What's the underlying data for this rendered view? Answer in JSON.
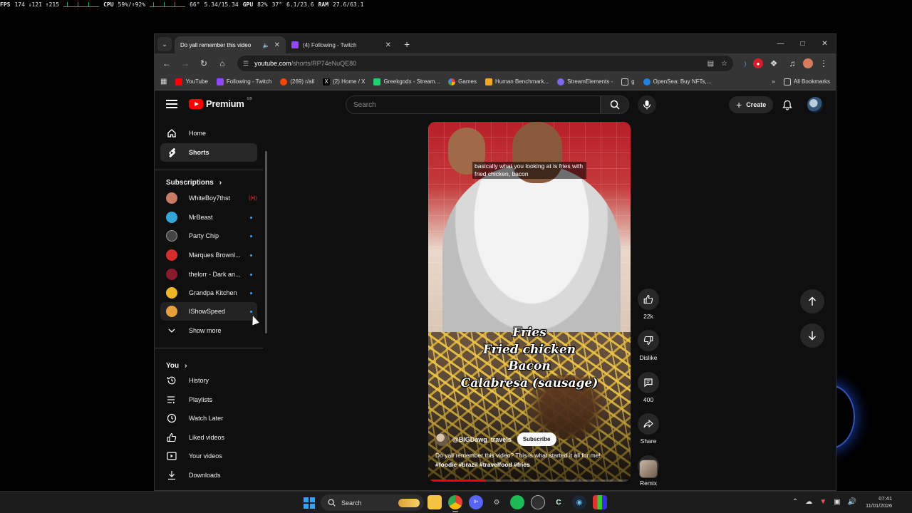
{
  "overlay": {
    "fps_label": "FPS",
    "fps_values": "174 ↓121 ↑215",
    "cpu_label": "CPU",
    "cpu_values": "59%/↑92%",
    "cpu_temp": "66°",
    "cpu_clock": "5.34/15.34",
    "gpu_label": "GPU",
    "gpu_values": "82%",
    "gpu_temp": "37°",
    "gpu_mem": "6.1/23.6",
    "ram_label": "RAM",
    "ram_values": "27.6/63.1"
  },
  "browser": {
    "tabs": [
      {
        "title": "Do yall remember this video",
        "active": true
      },
      {
        "title": "(4) Following - Twitch",
        "active": false
      }
    ],
    "url_host": "youtube.com",
    "url_path": "/shorts/RP74eNuQE80",
    "bookmarks": [
      {
        "label": "YouTube",
        "color": "#ff0000"
      },
      {
        "label": "Following - Twitch",
        "color": "#9146ff"
      },
      {
        "label": "(269) r/all",
        "color": "#ff4500"
      },
      {
        "label": "(2) Home / X",
        "color": "#ffffff"
      },
      {
        "label": "Greekgodx - Stream...",
        "color": "#1fcf70"
      },
      {
        "label": "Games",
        "color": "#e94235"
      },
      {
        "label": "Human Benchmark...",
        "color": "#f5a623"
      },
      {
        "label": "StreamElements -",
        "color": "#7b68ee"
      },
      {
        "label": "g",
        "color": "#cccccc"
      },
      {
        "label": "OpenSea: Buy NFTs,...",
        "color": "#2081e2"
      }
    ],
    "all_bookmarks_label": "All Bookmarks"
  },
  "youtube": {
    "brand": "Premium",
    "country_code": "GB",
    "search_placeholder": "Search",
    "create_label": "Create",
    "nav": [
      {
        "label": "Home",
        "icon": "home-icon"
      },
      {
        "label": "Shorts",
        "icon": "shorts-icon",
        "active": true
      }
    ],
    "subscriptions_label": "Subscriptions",
    "subscriptions": [
      {
        "name": "WhiteBoy7thst",
        "status": "live",
        "color": "#c97b63"
      },
      {
        "name": "MrBeast",
        "status": "new",
        "color": "#2fa8d9"
      },
      {
        "name": "Party Chip",
        "status": "new",
        "color": "#444444"
      },
      {
        "name": "Marques Brownl...",
        "status": "new",
        "color": "#d72c2c"
      },
      {
        "name": "thelorr - Dark an...",
        "status": "new",
        "color": "#8a1b2a"
      },
      {
        "name": "Grandpa Kitchen",
        "status": "new",
        "color": "#f0b429"
      },
      {
        "name": "IShowSpeed",
        "status": "new",
        "color": "#e8a13a"
      }
    ],
    "show_more_label": "Show more",
    "you_label": "You",
    "you_items": [
      {
        "label": "History",
        "icon": "history-icon"
      },
      {
        "label": "Playlists",
        "icon": "playlists-icon"
      },
      {
        "label": "Watch Later",
        "icon": "watch-later-icon"
      },
      {
        "label": "Liked videos",
        "icon": "liked-videos-icon"
      },
      {
        "label": "Your videos",
        "icon": "your-videos-icon"
      },
      {
        "label": "Downloads",
        "icon": "downloads-icon"
      }
    ]
  },
  "short": {
    "caption_top": "basically what you looking at is fries with fried chicken, bacon",
    "overlay_lines": [
      "Fries",
      "Fried chicken",
      "Bacon",
      "Calabresa (sausage)"
    ],
    "channel": "@BIGDawg_travels",
    "subscribe_label": "Subscribe",
    "description": "Do yall remember this video? This is what started it all for me!",
    "hashtags": "#foodie #brazil #travelfood #fries",
    "progress": 0.28,
    "likes": "22k",
    "dislike_label": "Dislike",
    "comments": "400",
    "share_label": "Share",
    "remix_label": "Remix"
  },
  "taskbar": {
    "search_label": "Search",
    "time": "07:41",
    "date": "11/01/2026",
    "discord_badge": "9+"
  }
}
